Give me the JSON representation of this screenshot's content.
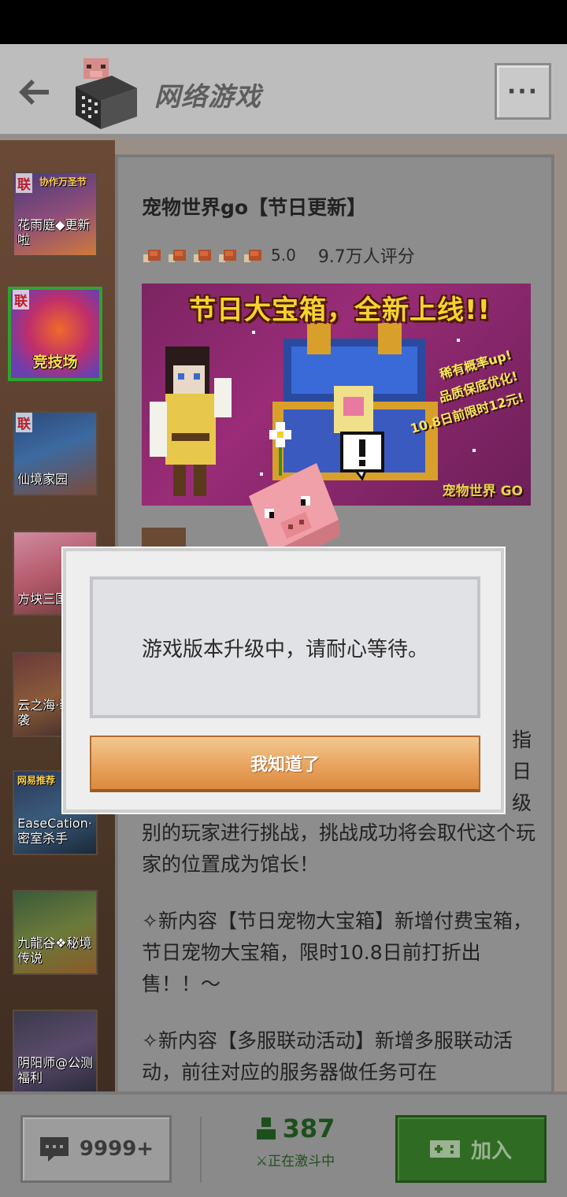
{
  "header": {
    "title": "网络游戏",
    "more_label": "···"
  },
  "sidebar": {
    "items": [
      {
        "tag": "联",
        "sub": "协作万圣节",
        "name": "花雨庭◆更新啦"
      },
      {
        "tag": "联",
        "sub": "",
        "name": "竞技场"
      },
      {
        "tag": "联",
        "sub": "",
        "name": "仙境家园"
      },
      {
        "tag": "",
        "sub": "",
        "name": "方块三国"
      },
      {
        "tag": "",
        "sub": "",
        "name": "云之海·装来袭"
      },
      {
        "tag": "",
        "sub": "网易推荐",
        "name": "EaseCation·密室杀手"
      },
      {
        "tag": "",
        "sub": "",
        "name": "九龍谷❖秘境传说"
      },
      {
        "tag": "",
        "sub": "",
        "name": "阴阳师@公测福利"
      }
    ]
  },
  "game": {
    "title": "宠物世界go【节日更新】",
    "score": "5.0",
    "rating_count": "9.7万人评分",
    "rating_meats": 5,
    "banner": {
      "title": "节日大宝箱，全新上线!!",
      "side_lines": [
        "稀有概率up!",
        "品质保底优化!",
        "10.8日前限时12元!"
      ],
      "logo": "宠物世界 GO"
    },
    "desc": {
      "partial_lines": [
        "指",
        "日",
        "级"
      ],
      "p1": "别的玩家进行挑战，挑战成功将会取代这个玩家的位置成为馆长！",
      "p2": "✧新内容【节日宠物大宝箱】新增付费宝箱，节日宠物大宝箱，限时10.8日前打折出售！！～",
      "p3": "✧新内容【多服联动活动】新增多服联动活动，前往对应的服务器做任务可在"
    }
  },
  "bottom": {
    "comments": "9999+",
    "online_count": "387",
    "online_status": "⚔正在激斗中",
    "join_label": "加入"
  },
  "dialog": {
    "message": "游戏版本升级中，请耐心等待。",
    "ok_label": "我知道了"
  }
}
